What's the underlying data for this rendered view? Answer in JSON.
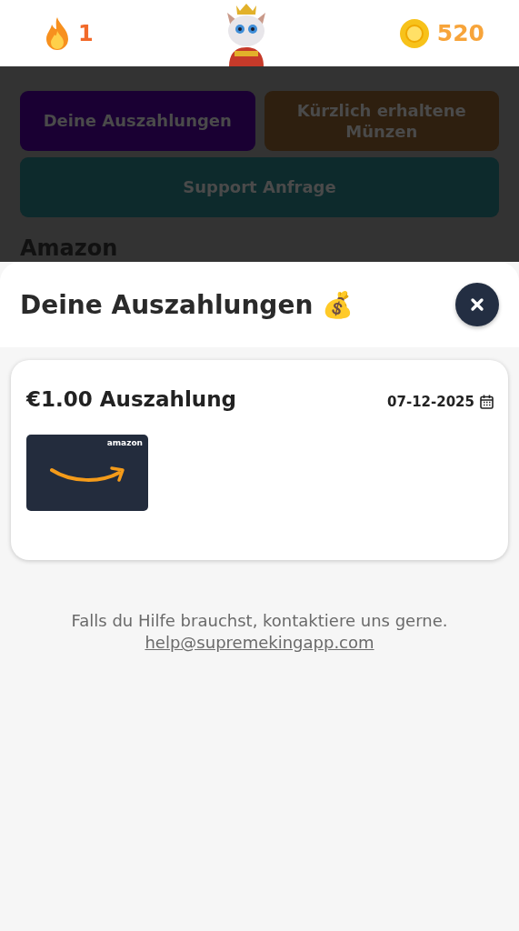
{
  "header": {
    "streak": "1",
    "coins": "520"
  },
  "background": {
    "tabs": [
      {
        "label": "Deine Auszahlungen",
        "color": "#1a0033"
      },
      {
        "label": "Kürzlich erhaltene Münzen",
        "color": "#2e1f0f"
      },
      {
        "label": "Support Anfrage",
        "color": "#0d2a2c"
      }
    ],
    "section_title": "Amazon"
  },
  "sheet": {
    "title": "Deine Auszahlungen",
    "title_emoji": "💰",
    "payouts": [
      {
        "title": "€1.00 Auszahlung",
        "date": "07-12-2025",
        "card_label": "amazon"
      }
    ],
    "help_text": "Falls du Hilfe brauchst, kontaktiere uns gerne.",
    "help_email": "help@supremekingapp.com"
  }
}
